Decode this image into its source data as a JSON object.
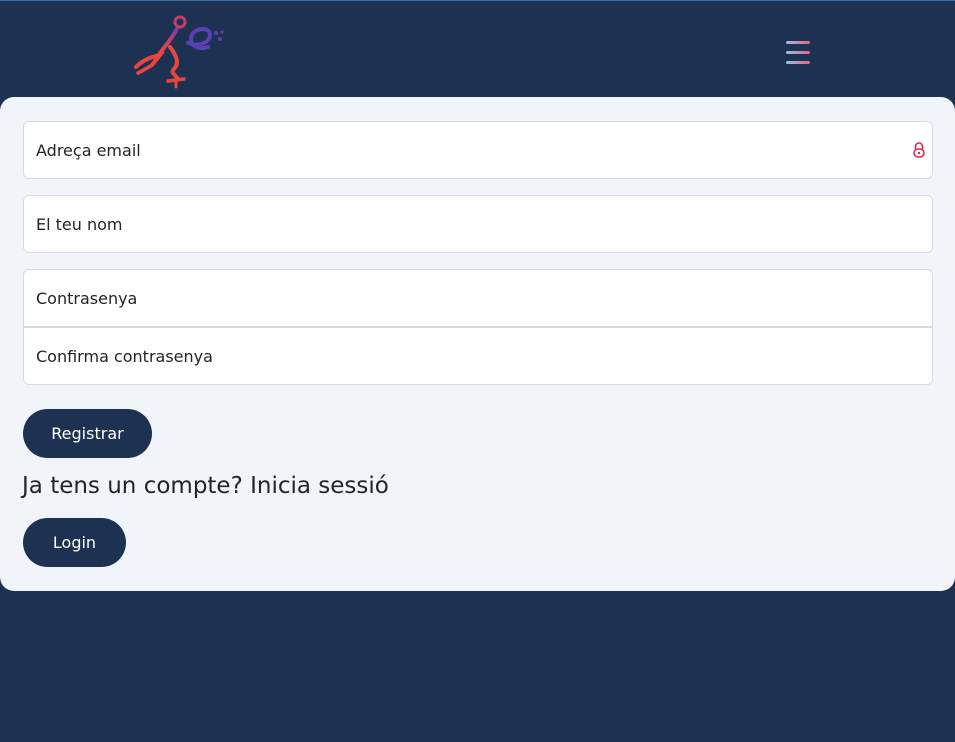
{
  "header": {
    "logo_icon": "brand-logo-figure",
    "menu_icon": "hamburger-menu-icon"
  },
  "form": {
    "email_placeholder": "Adreça email",
    "email_icon": "lock-icon",
    "name_placeholder": "El teu nom",
    "password_placeholder": "Contrasenya",
    "confirm_password_placeholder": "Confirma contrasenya",
    "register_label": "Registrar"
  },
  "login_section": {
    "prompt": "Ja tens un compte? Inicia sessió",
    "login_label": "Login"
  },
  "colors": {
    "background": "#1d3152",
    "card": "#f1f4f8",
    "button": "#1d3152",
    "accent_red": "#e0284a",
    "accent_blue": "#8fc2e8"
  }
}
